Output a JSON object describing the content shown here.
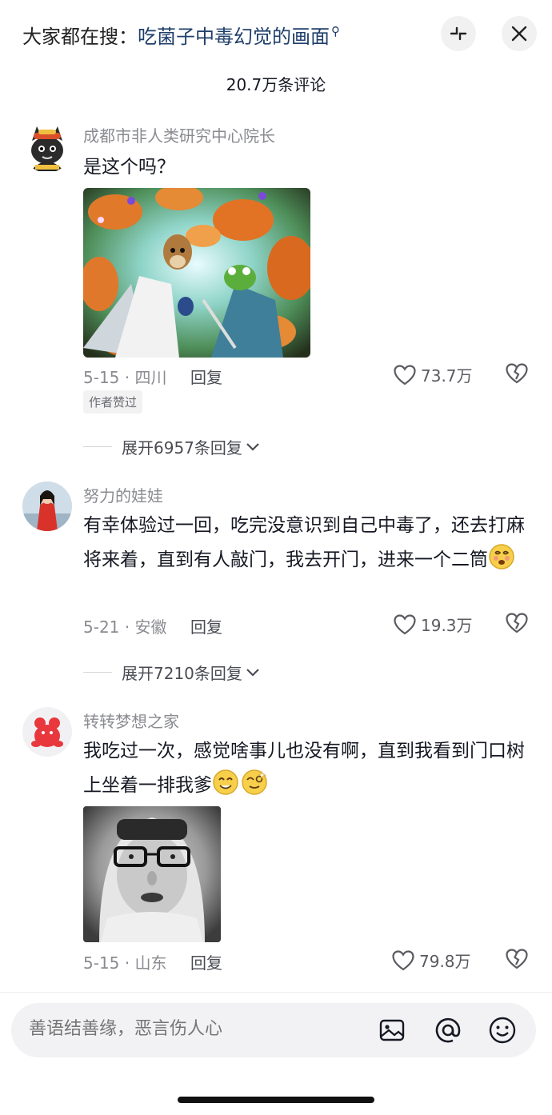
{
  "header": {
    "search_prefix": "大家都在搜：",
    "search_keyword": "吃菌子中毒幻觉的画面",
    "comment_count": "20.7万条评论"
  },
  "comments": [
    {
      "username": "成都市非人类研究中心院长",
      "text": "是这个吗？",
      "date_location": "5-15 · 四川",
      "reply_label": "回复",
      "likes": "73.7万",
      "badge": "作者赞过",
      "expand_label": "展开6957条回复"
    },
    {
      "username": "努力的娃娃",
      "text": "有幸体验过一回，吃完没意识到自己中毒了，还去打麻将来着，直到有人敲门，我去开门，进来一个二筒",
      "date_location": "5-21 · 安徽",
      "reply_label": "回复",
      "likes": "19.3万",
      "expand_label": "展开7210条回复"
    },
    {
      "username": "转转梦想之家",
      "text": "我吃过一次，感觉啥事儿也没有啊，直到我看到门口树上坐着一排我爹",
      "date_location": "5-15 · 山东",
      "reply_label": "回复",
      "likes": "79.8万"
    }
  ],
  "input": {
    "placeholder": "善语结善缘，恶言伤人心"
  },
  "icons": {
    "expand": "collapse-arrows-icon",
    "close": "close-icon",
    "like": "heart-icon",
    "dislike": "broken-heart-icon",
    "image": "image-icon",
    "mention": "at-icon",
    "emoji": "smiley-icon"
  },
  "colors": {
    "keyword": "#1f3f6b",
    "secondary_text": "#8a8b91",
    "primary_text": "#161823"
  }
}
